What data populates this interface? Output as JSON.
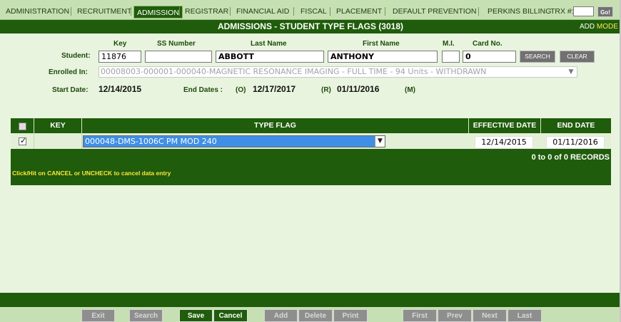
{
  "nav": {
    "items": [
      "ADMINISTRATION",
      "RECRUITMENT",
      "ADMISSION",
      "REGISTRAR",
      "FINANCIAL AID",
      "FISCAL",
      "PLACEMENT",
      "DEFAULT PREVENTION",
      "PERKINS BILLING"
    ],
    "active": "ADMISSION",
    "trx_label": "TRX #:",
    "trx_value": "",
    "go_label": "Go!"
  },
  "titlebar": {
    "title": "ADMISSIONS - STUDENT TYPE FLAGS (3018)",
    "add_label": "ADD",
    "mode_label": "MODE"
  },
  "student": {
    "label": "Student:",
    "headers": {
      "key": "Key",
      "ssn": "SS Number",
      "last": "Last Name",
      "first": "First Name",
      "mi": "M.I.",
      "card": "Card No."
    },
    "key": "11876",
    "ssn": "",
    "last_name": "ABBOTT",
    "first_name": "ANTHONY",
    "mi": "",
    "card_no": "0",
    "search_label": "SEARCH",
    "clear_label": "CLEAR"
  },
  "enrollment": {
    "label": "Enrolled In:",
    "value": "00008003-000001-000040-MAGNETIC RESONANCE IMAGING - FULL TIME - 94 Units - WITHDRAWN"
  },
  "dates": {
    "start_label": "Start Date:",
    "start_value": "12/14/2015",
    "end_label": "End Dates :",
    "o_label": "(O)",
    "o_value": "12/17/2017",
    "r_label": "(R)",
    "r_value": "01/11/2016",
    "m_label": "(M)"
  },
  "grid": {
    "headers": {
      "key": "KEY",
      "type_flag": "TYPE FLAG",
      "effective_date": "EFFECTIVE DATE",
      "end_date": "END DATE"
    },
    "row": {
      "checked": true,
      "key": "",
      "type_flag": "000048-DMS-1006C PM MOD 240",
      "effective_date": "12/14/2015",
      "end_date": "01/11/2016"
    },
    "records_text": "0 to 0 of 0 RECORDS",
    "hint": "Click/Hit on CANCEL or UNCHECK to cancel data entry"
  },
  "toolbar": {
    "exit": "Exit",
    "search": "Search",
    "save": "Save",
    "cancel": "Cancel",
    "add": "Add",
    "delete": "Delete",
    "print": "Print",
    "first": "First",
    "prev": "Prev",
    "next": "Next",
    "last": "Last"
  }
}
